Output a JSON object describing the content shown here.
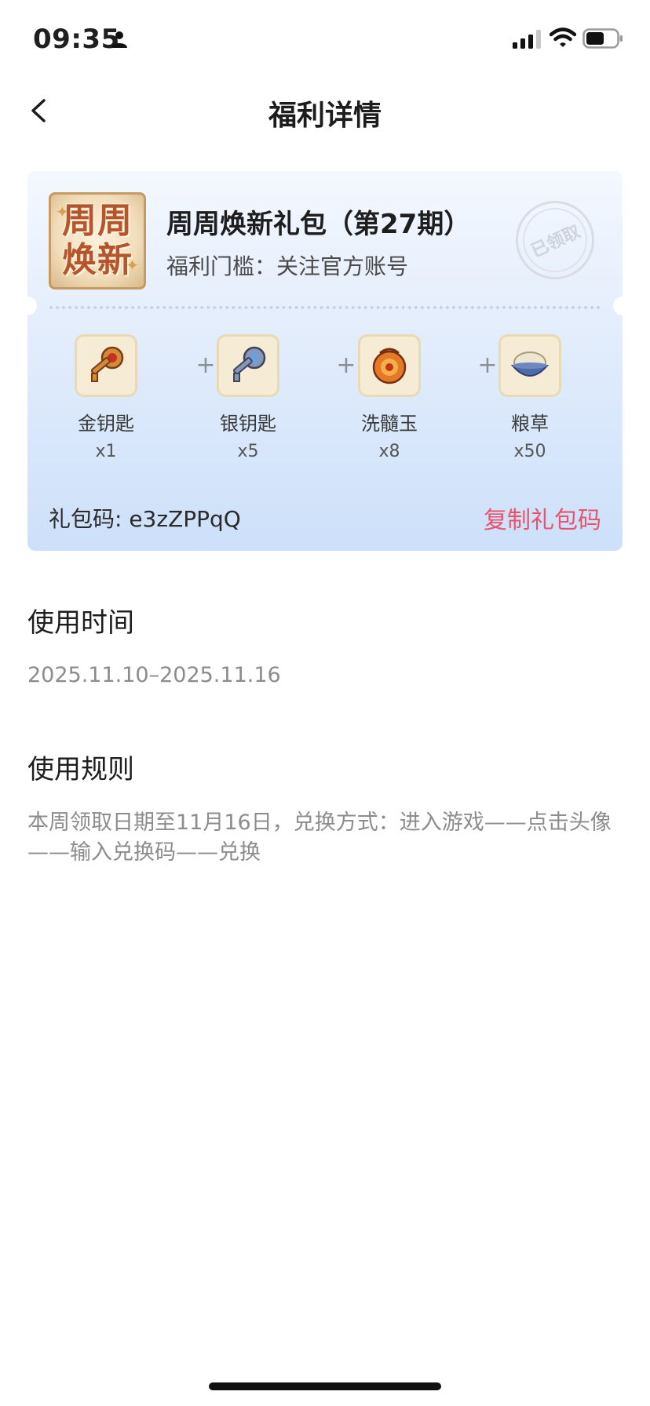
{
  "status_bar": {
    "time": "09:35",
    "icons": [
      "person-icon",
      "signal-icon",
      "wifi-icon",
      "battery-icon"
    ]
  },
  "nav": {
    "title": "福利详情",
    "back_icon": "chevron-left-icon"
  },
  "gift": {
    "logo_text_line1": "周周",
    "logo_text_line2": "焕新",
    "title": "周周焕新礼包（第27期）",
    "threshold": "福利门槛：关注官方账号",
    "stamp_text": "已领取",
    "items": [
      {
        "icon": "gold-key-icon",
        "name": "金钥匙",
        "qty": "x1"
      },
      {
        "icon": "silver-key-icon",
        "name": "银钥匙",
        "qty": "x5"
      },
      {
        "icon": "marrow-jade-icon",
        "name": "洗髓玉",
        "qty": "x8"
      },
      {
        "icon": "grain-bowl-icon",
        "name": "粮草",
        "qty": "x50"
      }
    ],
    "plus": "+",
    "code_label": "礼包码: e3zZPPqQ",
    "copy_label": "复制礼包码"
  },
  "usage_time": {
    "heading": "使用时间",
    "value": "2025.11.10–2025.11.16"
  },
  "usage_rules": {
    "heading": "使用规则",
    "text": "本周领取日期至11月16日，兑换方式：进入游戏——点击头像——输入兑换码——兑换"
  },
  "colors": {
    "accent_copy": "#e8546d",
    "card_gradient_top": "#f4f8ff",
    "card_gradient_bottom": "#cde0fa"
  }
}
